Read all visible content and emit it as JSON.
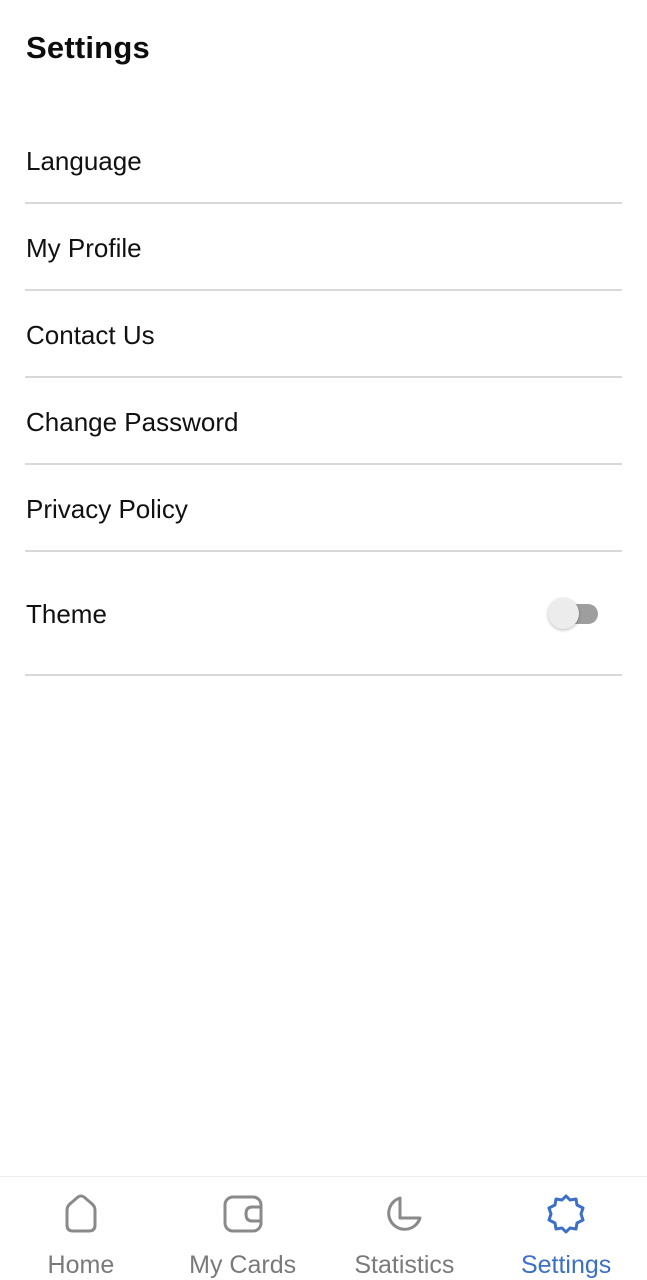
{
  "header": {
    "title": "Settings"
  },
  "settings": {
    "items": [
      {
        "label": "Language"
      },
      {
        "label": "My Profile"
      },
      {
        "label": "Contact Us"
      },
      {
        "label": "Change Password"
      },
      {
        "label": "Privacy Policy"
      }
    ],
    "theme": {
      "label": "Theme",
      "toggle_on": false
    }
  },
  "bottom_nav": {
    "active_color": "#3b6fc8",
    "inactive_color": "#7a7a7a",
    "items": [
      {
        "label": "Home",
        "icon": "home-icon",
        "active": false
      },
      {
        "label": "My Cards",
        "icon": "wallet-icon",
        "active": false
      },
      {
        "label": "Statistics",
        "icon": "pie-chart-icon",
        "active": false
      },
      {
        "label": "Settings",
        "icon": "settings-gear-icon",
        "active": true
      }
    ]
  }
}
